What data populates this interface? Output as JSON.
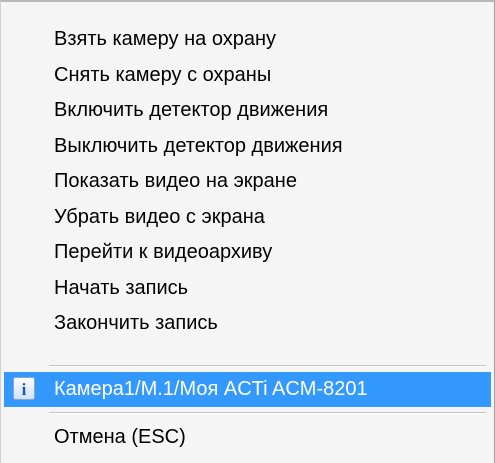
{
  "menu": {
    "items": [
      {
        "label": "Взять камеру на охрану"
      },
      {
        "label": "Снять камеру с охраны"
      },
      {
        "label": "Включить детектор движения"
      },
      {
        "label": "Выключить детектор движения"
      },
      {
        "label": "Показать видео на экране"
      },
      {
        "label": "Убрать видео с экрана"
      },
      {
        "label": "Перейти к видеоархиву"
      },
      {
        "label": "Начать запись"
      },
      {
        "label": "Закончить запись"
      }
    ],
    "camera_item": {
      "label": "Камера1/М.1/Моя ACTi ACM-8201",
      "icon": "info-icon",
      "icon_glyph": "i",
      "highlight_color": "#3399ff"
    },
    "cancel_item": {
      "label": "Отмена (ESC)"
    }
  }
}
